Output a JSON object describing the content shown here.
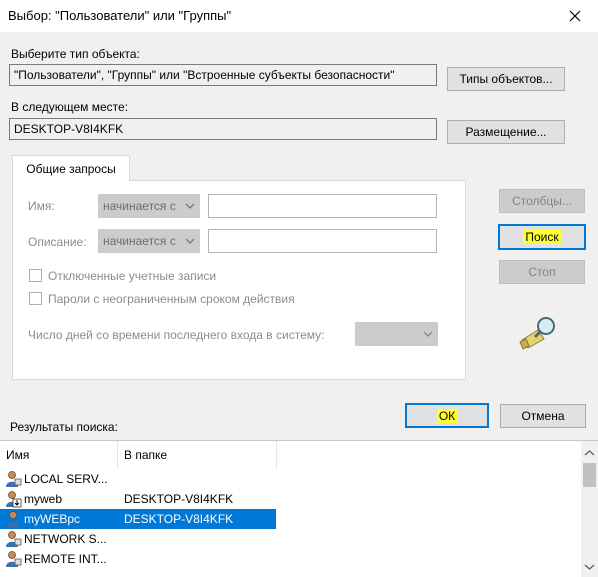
{
  "window": {
    "title": "Выбор: \"Пользователи\" или \"Группы\"",
    "close_glyph": "✕"
  },
  "object_type": {
    "label": "Выберите тип объекта:",
    "value": "\"Пользователи\", \"Группы\" или \"Встроенные субъекты безопасности\"",
    "button": "Типы объектов..."
  },
  "location": {
    "label": "В следующем месте:",
    "value": "DESKTOP-V8I4KFK",
    "button": "Размещение..."
  },
  "tab": {
    "label": "Общие запросы"
  },
  "query": {
    "name_label": "Имя:",
    "name_combo": "начинается с",
    "desc_label": "Описание:",
    "desc_combo": "начинается с",
    "disabled_accounts": "Отключенные учетные записи",
    "nonexpiring_passwords": "Пароли с неограниченным сроком действия",
    "days_label": "Число дней со времени последнего входа в систему:"
  },
  "buttons": {
    "columns": "Столбцы...",
    "search": "Поиск",
    "stop": "Стоп",
    "ok": "ОК",
    "cancel": "Отмена"
  },
  "results": {
    "label": "Результаты поиска:",
    "col_name": "Имя",
    "col_folder": "В папке",
    "rows": [
      {
        "name": "LOCAL SERV...",
        "folder": "",
        "icon": "builtin-user-icon"
      },
      {
        "name": "myweb",
        "folder": "DESKTOP-V8I4KFK",
        "icon": "user-down-icon"
      },
      {
        "name": "myWEBpc",
        "folder": "DESKTOP-V8I4KFK",
        "icon": "user-icon",
        "selected": true
      },
      {
        "name": "NETWORK S...",
        "folder": "",
        "icon": "builtin-user-icon"
      },
      {
        "name": "REMOTE INT...",
        "folder": "",
        "icon": "builtin-user-icon"
      }
    ]
  },
  "colors": {
    "selection": "#0078d7",
    "highlight": "#ffff33"
  }
}
